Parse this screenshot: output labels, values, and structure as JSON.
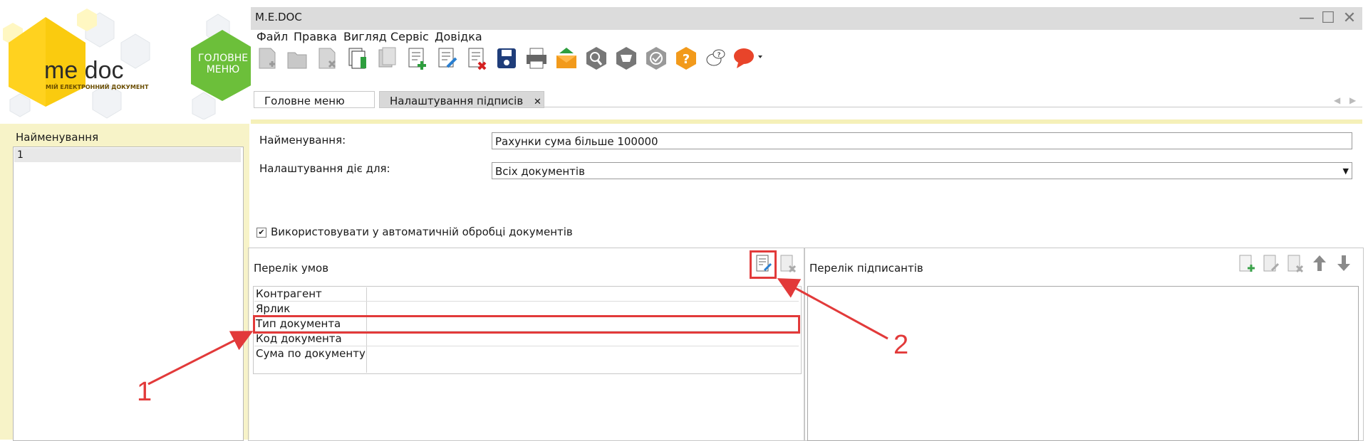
{
  "logo": {
    "brand": "me doc",
    "tagline": "МІЙ ЕЛЕКТРОННИЙ ДОКУМЕНТ",
    "home_label": "ГОЛОВНЕ МЕНЮ"
  },
  "window": {
    "title": "M.E.DOC"
  },
  "menu": [
    "Файл",
    "Правка",
    "Вигляд",
    "Сервіс",
    "Довідка"
  ],
  "toolbar_icons": [
    "new-doc-icon",
    "open-doc-icon",
    "delete-doc-icon",
    "copy-doc-icon",
    "duplicate-doc-icon",
    "add-doc-icon",
    "edit-doc-icon",
    "remove-doc-icon",
    "save-icon",
    "print-icon",
    "send-icon",
    "search-icon",
    "inbox-icon",
    "sign-icon",
    "help-icon",
    "chat-icon",
    "feedback-icon"
  ],
  "tabs": [
    {
      "label": "Головне меню",
      "active": false
    },
    {
      "label": "Налаштування підписів",
      "active": true,
      "close": "✕"
    }
  ],
  "left_panel": {
    "title": "Найменування",
    "items": [
      "1"
    ]
  },
  "form": {
    "name_label": "Найменування:",
    "name_value": "Рахунки сума більше 100000",
    "applies_label": "Налаштування діє для:",
    "applies_value": "Всіх документів",
    "auto_checkbox_label": "Використовувати у автоматичній обробці документів",
    "auto_checked": true
  },
  "conditions": {
    "title": "Перелік умов",
    "rows": [
      "Контрагент",
      "Ярлик",
      "Тип документа",
      "Код документа",
      "Сума по документу"
    ]
  },
  "signers": {
    "title": "Перелік підписантів"
  },
  "annotations": {
    "first": "1",
    "second": "2"
  },
  "colors": {
    "accent_red": "#e23a3a",
    "logo_yellow": "#ffd21f",
    "logo_green": "#6cbf3a",
    "panel_yellow": "#f7f3c8"
  }
}
